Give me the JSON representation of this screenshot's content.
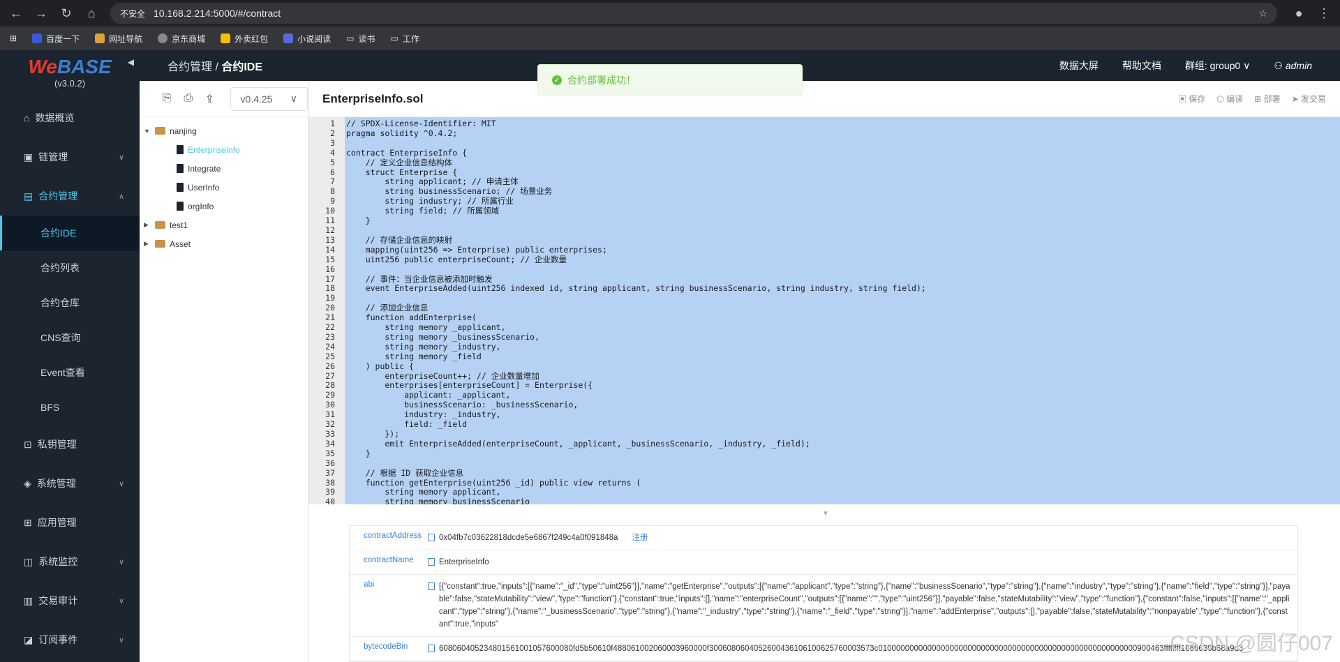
{
  "browser": {
    "security": "不安全",
    "url": "10.168.2.214:5000/#/contract"
  },
  "bookmarks": [
    "百度一下",
    "网址导航",
    "京东商城",
    "外卖红包",
    "小说阅读",
    "读书",
    "工作"
  ],
  "logo": {
    "we": "We",
    "base": "BASE",
    "version": "(v3.0.2)"
  },
  "sidebar": {
    "items": [
      {
        "label": "数据概览"
      },
      {
        "label": "链管理"
      },
      {
        "label": "合约管理"
      },
      {
        "label": "合约IDE"
      },
      {
        "label": "合约列表"
      },
      {
        "label": "合约仓库"
      },
      {
        "label": "CNS查询"
      },
      {
        "label": "Event查看"
      },
      {
        "label": "BFS"
      },
      {
        "label": "私钥管理"
      },
      {
        "label": "系统管理"
      },
      {
        "label": "应用管理"
      },
      {
        "label": "系统监控"
      },
      {
        "label": "交易审计"
      },
      {
        "label": "订阅事件"
      }
    ]
  },
  "header": {
    "crumb_parent": "合约管理 / ",
    "crumb_current": "合约IDE",
    "screen": "数据大屏",
    "docs": "帮助文档",
    "group": "群组: group0",
    "user": "admin"
  },
  "toast": {
    "text": "合约部署成功！"
  },
  "tree": {
    "version": "v0.4.25",
    "root": "nanjing",
    "files": [
      "EnterpriseInfo",
      "Integrate",
      "UserInfo",
      "orgInfo"
    ],
    "folders": [
      "test1",
      "Asset"
    ]
  },
  "editor": {
    "title": "EnterpriseInfo.sol",
    "save": "保存",
    "compile": "编译",
    "deploy": "部署",
    "send": "发交易",
    "line_numbers": "1\n2\n3\n4\n5\n6\n7\n8\n9\n10\n11\n12\n13\n14\n15\n16\n17\n18\n19\n20\n21\n22\n23\n24\n25\n26\n27\n28\n29\n30\n31\n32\n33\n34\n35\n36\n37\n38\n39\n40",
    "code": "// SPDX-License-Identifier: MIT\npragma solidity ^0.4.2;\n\ncontract EnterpriseInfo {\n    // 定义企业信息结构体\n    struct Enterprise {\n        string applicant; // 申请主体\n        string businessScenario; // 场景业务\n        string industry; // 所属行业\n        string field; // 所属领域\n    }\n\n    // 存储企业信息的映射\n    mapping(uint256 => Enterprise) public enterprises;\n    uint256 public enterpriseCount; // 企业数量\n\n    // 事件：当企业信息被添加时触发\n    event EnterpriseAdded(uint256 indexed id, string applicant, string businessScenario, string industry, string field);\n\n    // 添加企业信息\n    function addEnterprise(\n        string memory _applicant,\n        string memory _businessScenario,\n        string memory _industry,\n        string memory _field\n    ) public {\n        enterpriseCount++; // 企业数量增加\n        enterprises[enterpriseCount] = Enterprise({\n            applicant: _applicant,\n            businessScenario: _businessScenario,\n            industry: _industry,\n            field: _field\n        });\n        emit EnterpriseAdded(enterpriseCount, _applicant, _businessScenario, _industry, _field);\n    }\n\n    // 根据 ID 获取企业信息\n    function getEnterprise(uint256 _id) public view returns (\n        string memory applicant,\n        string memory businessScenario"
  },
  "info": {
    "address_key": "contractAddress",
    "address_val": "0x04fb7c03622818dcde5e6867f249c4a0f091848a",
    "register": "注册",
    "name_key": "contractName",
    "name_val": "EnterpriseInfo",
    "abi_key": "abi",
    "abi_val": "[{\"constant\":true,\"inputs\":[{\"name\":\"_id\",\"type\":\"uint256\"}],\"name\":\"getEnterprise\",\"outputs\":[{\"name\":\"applicant\",\"type\":\"string\"},{\"name\":\"businessScenario\",\"type\":\"string\"},{\"name\":\"industry\",\"type\":\"string\"},{\"name\":\"field\",\"type\":\"string\"}],\"payable\":false,\"stateMutability\":\"view\",\"type\":\"function\"},{\"constant\":true,\"inputs\":[],\"name\":\"enterpriseCount\",\"outputs\":[{\"name\":\"\",\"type\":\"uint256\"}],\"payable\":false,\"stateMutability\":\"view\",\"type\":\"function\"},{\"constant\":false,\"inputs\":[{\"name\":\"_applicant\",\"type\":\"string\"},{\"name\":\"_businessScenario\",\"type\":\"string\"},{\"name\":\"_industry\",\"type\":\"string\"},{\"name\":\"_field\",\"type\":\"string\"}],\"name\":\"addEnterprise\",\"outputs\":[],\"payable\":false,\"stateMutability\":\"nonpayable\",\"type\":\"function\"},{\"constant\":true,\"inputs\"",
    "bin_key": "bytecodeBin",
    "bin_val": "608060405234801561001057600080fd5b50610f488061002060003960000f3006080604052600436106100625760003573c0100000000000000000000000000000000000000000000000000000000900463ffffffff1680630b68a9d3"
  },
  "watermark": "CSDN @圆仔007"
}
